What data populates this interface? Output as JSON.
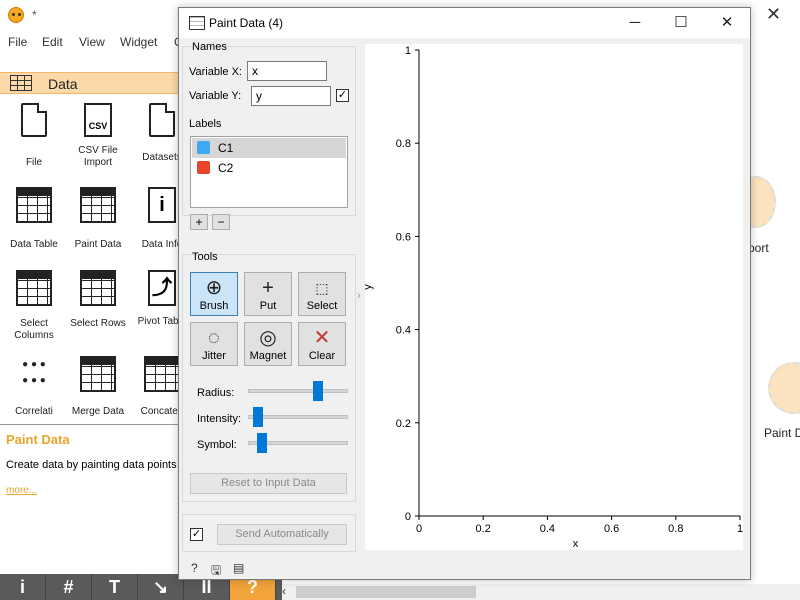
{
  "background_app": {
    "title_asterisk": "*",
    "menu": [
      "File",
      "Edit",
      "View",
      "Widget",
      "O"
    ],
    "category": "Data",
    "widgets": [
      {
        "label": "File",
        "icon": "file-icon"
      },
      {
        "label": "CSV File Import",
        "icon": "csv-icon"
      },
      {
        "label": "Datasets",
        "icon": "datasets-icon"
      },
      {
        "label": "Data Table",
        "icon": "table-icon"
      },
      {
        "label": "Paint Data",
        "icon": "paint-data-icon"
      },
      {
        "label": "Data Info",
        "icon": "info-icon"
      },
      {
        "label": "Select Columns",
        "icon": "select-columns-icon"
      },
      {
        "label": "Select Rows",
        "icon": "select-rows-icon"
      },
      {
        "label": "Pivot Table",
        "icon": "pivot-icon"
      },
      {
        "label": "Correlati",
        "icon": "correlations-icon"
      },
      {
        "label": "Merge Data",
        "icon": "merge-data-icon"
      },
      {
        "label": "Concaten",
        "icon": "concatenate-icon"
      }
    ],
    "help": {
      "title": "Paint Data",
      "text": "Create data by painting data points",
      "more": "more..."
    },
    "toolbar": [
      "i",
      "#",
      "T",
      "↘",
      "II",
      "?"
    ],
    "canvas_nodes": [
      {
        "label": "port"
      },
      {
        "label": "Paint D"
      }
    ]
  },
  "dialog": {
    "title": "Paint Data (4)",
    "names_group": "Names",
    "variable_x_label": "Variable X:",
    "variable_x_value": "x",
    "variable_y_label": "Variable Y:",
    "variable_y_value": "y",
    "variable_y_checked": true,
    "labels_group": "Labels",
    "labels": [
      {
        "name": "C1",
        "color": "#3fa9f5",
        "selected": true
      },
      {
        "name": "C2",
        "color": "#e8452c",
        "selected": false
      }
    ],
    "add_label": "+",
    "remove_label": "−",
    "tools_group": "Tools",
    "tools": [
      {
        "label": "Brush",
        "icon": "brush-icon",
        "active": true
      },
      {
        "label": "Put",
        "icon": "put-icon",
        "active": false
      },
      {
        "label": "Select",
        "icon": "select-icon",
        "active": false
      },
      {
        "label": "Jitter",
        "icon": "jitter-icon",
        "active": false
      },
      {
        "label": "Magnet",
        "icon": "magnet-icon",
        "active": false
      },
      {
        "label": "Clear",
        "icon": "clear-icon",
        "active": false
      }
    ],
    "radius_label": "Radius:",
    "radius_value": 0.72,
    "intensity_label": "Intensity:",
    "intensity_value": 0.05,
    "symbol_label": "Symbol:",
    "symbol_value": 0.1,
    "reset_button": "Reset to Input Data",
    "send_auto_checked": true,
    "send_button": "Send Automatically"
  },
  "chart_data": {
    "type": "scatter",
    "x": [],
    "y": [],
    "xlabel": "x",
    "ylabel": "y",
    "xlim": [
      0,
      1
    ],
    "ylim": [
      0,
      1
    ],
    "xticks": [
      "0",
      "0.2",
      "0.4",
      "0.6",
      "0.8",
      "1"
    ],
    "yticks": [
      "0",
      "0.2",
      "0.4",
      "0.6",
      "0.8",
      "1"
    ],
    "grid": false
  }
}
